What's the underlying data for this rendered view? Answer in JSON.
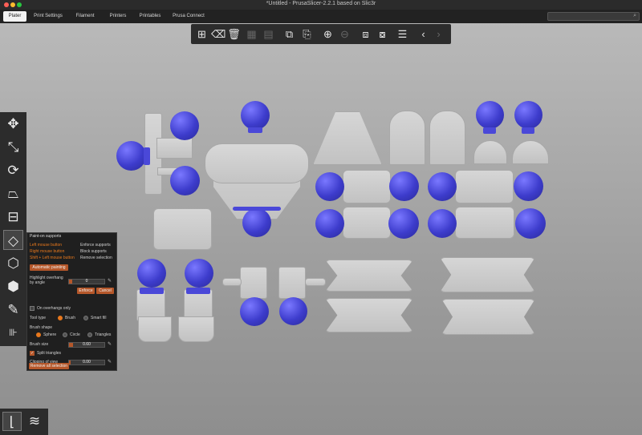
{
  "window": {
    "title": "*Untitled - PrusaSlicer-2.2.1 based on Slic3r"
  },
  "tabs": [
    {
      "label": "Plater"
    },
    {
      "label": "Print Settings"
    },
    {
      "label": "Filament"
    },
    {
      "label": "Printers"
    },
    {
      "label": "Printables"
    },
    {
      "label": "Prusa Connect"
    }
  ],
  "panel": {
    "title": "Paint-on supports",
    "left_mouse": "Left mouse button",
    "left_mouse_action": "Enforce supports",
    "right_mouse": "Right mouse button",
    "right_mouse_action": "Block supports",
    "shift_mouse": "Shift + Left mouse button",
    "shift_mouse_action": "Remove selection",
    "automatic_button": "Automatic painting",
    "threshold_label": "Highlight overhang by angle",
    "threshold_value": "0",
    "enforce_button": "Enforce",
    "cancel_button": "Cancel",
    "on_overhangs_label": "On overhangs only",
    "tool_type_label": "Tool type",
    "tool_brush": "Brush",
    "tool_fill": "Smart fill",
    "brush_shape_label": "Brush shape",
    "shape_sphere": "Sphere",
    "shape_circle": "Circle",
    "shape_triangle": "Triangles",
    "brush_size_label": "Brush size",
    "brush_size_value": "0.60",
    "split_triangles_label": "Split triangles",
    "clipping_label": "Clipping of view",
    "clipping_value": "0.00",
    "remove_all_button": "Remove all selection"
  },
  "icons": {
    "toolbar": [
      "add-icon",
      "delete-icon",
      "delete-all-icon",
      "arrange-icon",
      "arrange-selection-icon",
      "copy-icon",
      "paste-icon",
      "add-instance-icon",
      "remove-instance-icon",
      "split-objects-icon",
      "split-parts-icon",
      "layers-editing-icon",
      "undo-icon",
      "redo-icon"
    ],
    "left": [
      "move-icon",
      "scale-icon",
      "rotate-icon",
      "place-on-face-icon",
      "cut-icon",
      "paint-supports-icon",
      "seam-painting-icon",
      "multimaterial-painting-icon",
      "measure-icon",
      "emboss-icon"
    ],
    "bottom": [
      "view-3d-icon",
      "preview-icon"
    ]
  },
  "colors": {
    "accent": "#e8781c",
    "model_part": "#cccccc",
    "support_paint": "#4a48d8"
  }
}
